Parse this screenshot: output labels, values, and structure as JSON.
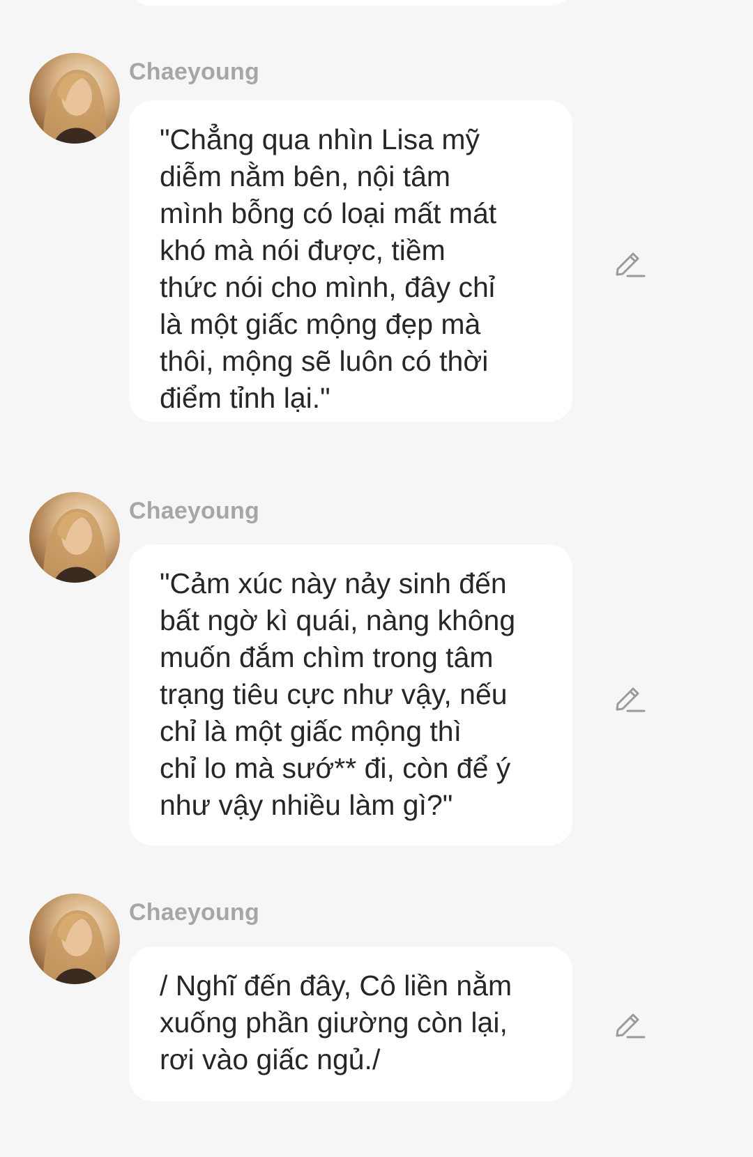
{
  "messages": [
    {
      "sender": "Chaeyoung",
      "text": "\"Chẳng qua nhìn Lisa mỹ\ndiễm nằm bên, nội tâm\nmình bỗng có loại mất mát\nkhó mà nói được, tiềm\nthức nói cho mình, đây chỉ\nlà một giấc mộng đẹp mà\nthôi, mộng sẽ luôn có thời\nđiểm tỉnh lại.\""
    },
    {
      "sender": "Chaeyoung",
      "text": "\"Cảm xúc này nảy sinh đến\nbất ngờ kì quái, nàng không\nmuốn đắm chìm trong tâm\ntrạng tiêu cực như vậy, nếu\nchỉ là một giấc mộng thì\nchỉ lo mà sướ** đi, còn để ý\nnhư vậy nhiều làm gì?\""
    },
    {
      "sender": "Chaeyoung",
      "text": "/ Nghĩ đến đây, Cô liền nằm\nxuống phần giường còn lại,\nrơi vào giấc ngủ./"
    }
  ],
  "icons": {
    "edit": "pencil-edit-icon",
    "avatar": "user-avatar-photo"
  },
  "colors": {
    "background": "#f6f6f6",
    "bubble": "#ffffff",
    "sender_name": "#a6a6a6",
    "message_text": "#262626",
    "edit_icon": "#9a9a9a"
  }
}
